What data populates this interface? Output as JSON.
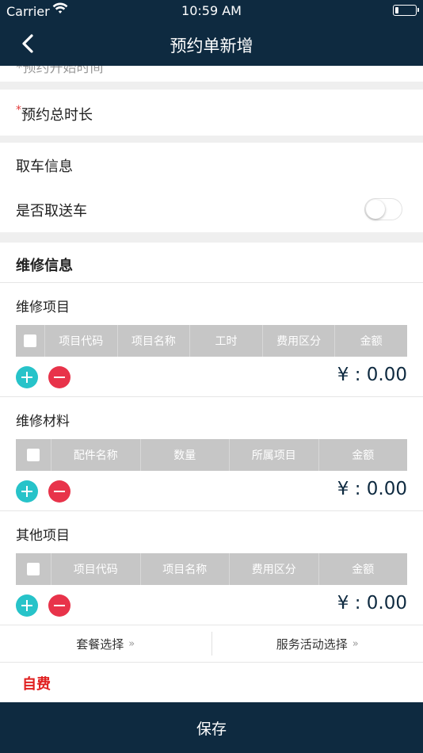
{
  "status_bar": {
    "carrier": "Carrier",
    "time": "10:59 AM"
  },
  "nav": {
    "title": "预约单新增"
  },
  "form": {
    "partial_row_label": "*预约开始时间",
    "duration_required_mark": "*",
    "duration_label": "预约总时长"
  },
  "pickup": {
    "header": "取车信息",
    "toggle_label": "是否取送车",
    "toggle_on": false
  },
  "repair": {
    "header": "维修信息",
    "items": {
      "title": "维修项目",
      "columns": [
        "项目代码",
        "项目名称",
        "工时",
        "费用区分",
        "金额"
      ],
      "total": "¥ : 0.00"
    },
    "materials": {
      "title": "维修材料",
      "columns": [
        "配件名称",
        "数量",
        "所属项目",
        "金额"
      ],
      "total": "¥ : 0.00"
    },
    "others": {
      "title": "其他项目",
      "columns": [
        "项目代码",
        "项目名称",
        "费用区分",
        "金额"
      ],
      "total": "¥ : 0.00"
    }
  },
  "selectors": {
    "package_label": "套餐选择",
    "activity_label": "服务活动选择",
    "chevron": "»"
  },
  "payment": {
    "label": "自费"
  },
  "footer": {
    "save_label": "保存"
  },
  "colors": {
    "nav_bg": "#0e2a40",
    "add": "#27c3c9",
    "delete": "#e8334a",
    "selfpay": "#e02020"
  }
}
